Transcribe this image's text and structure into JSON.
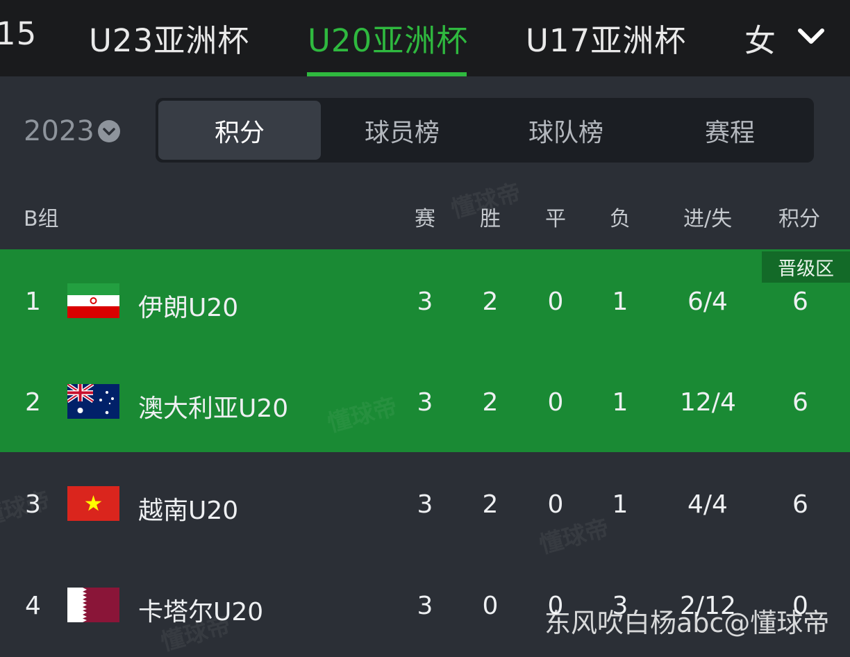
{
  "top_tabs": [
    {
      "label": "15"
    },
    {
      "label": "U23亚洲杯"
    },
    {
      "label": "U20亚洲杯",
      "active": true
    },
    {
      "label": "U17亚洲杯"
    },
    {
      "label": "女"
    }
  ],
  "year": "2023",
  "segments": [
    {
      "label": "积分",
      "active": true
    },
    {
      "label": "球员榜"
    },
    {
      "label": "球队榜"
    },
    {
      "label": "赛程"
    }
  ],
  "table": {
    "group": "B组",
    "columns": [
      "赛",
      "胜",
      "平",
      "负",
      "进/失",
      "积分"
    ],
    "promo_label": "晋级区",
    "rows": [
      {
        "rank": "1",
        "team": "伊朗U20",
        "flag": "iran-flag-icon",
        "p": "3",
        "w": "2",
        "d": "0",
        "l": "1",
        "gf_ga": "6/4",
        "pts": "6"
      },
      {
        "rank": "2",
        "team": "澳大利亚U20",
        "flag": "australia-flag-icon",
        "p": "3",
        "w": "2",
        "d": "0",
        "l": "1",
        "gf_ga": "12/4",
        "pts": "6"
      },
      {
        "rank": "3",
        "team": "越南U20",
        "flag": "vietnam-flag-icon",
        "p": "3",
        "w": "2",
        "d": "0",
        "l": "1",
        "gf_ga": "4/4",
        "pts": "6"
      },
      {
        "rank": "4",
        "team": "卡塔尔U20",
        "flag": "qatar-flag-icon",
        "p": "3",
        "w": "0",
        "d": "0",
        "l": "3",
        "gf_ga": "2/12",
        "pts": "0"
      }
    ]
  },
  "watermark": "懂球帝",
  "credit": "东风吹白杨abc@懂球帝",
  "colors": {
    "accent_green": "#2fb93f",
    "promotion_zone": "#1a8a34",
    "background": "#2b2f36",
    "topbar": "#1a1b1d"
  }
}
